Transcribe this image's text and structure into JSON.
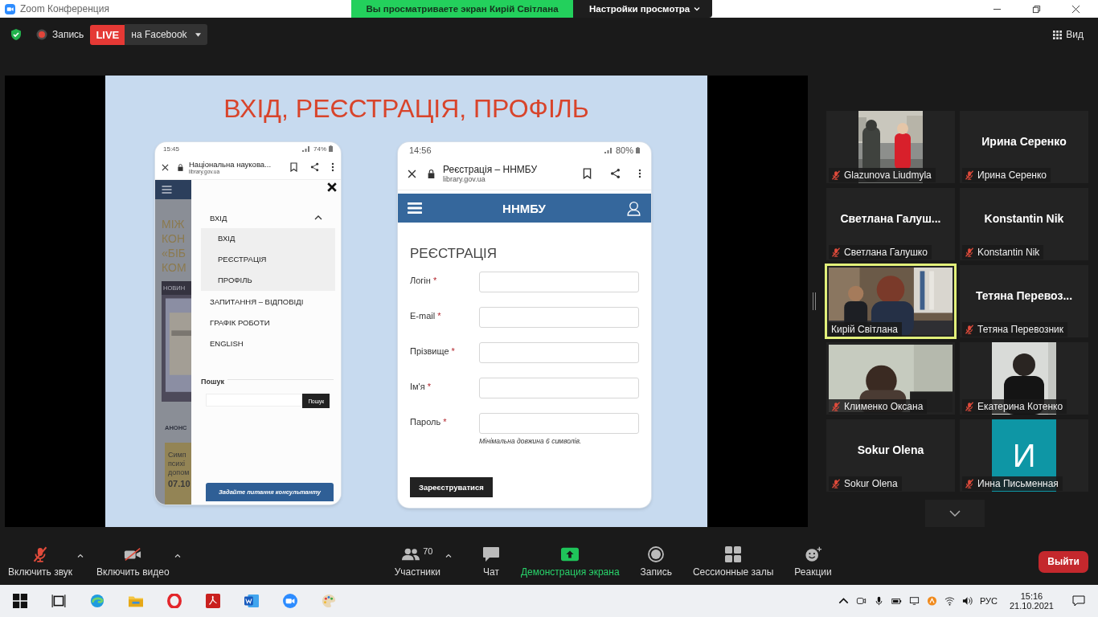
{
  "window": {
    "title": "Zoom Конференция"
  },
  "share_banner": {
    "text": "Вы просматриваете экран Кирій Світлана",
    "options": "Настройки просмотра"
  },
  "top_toolbar": {
    "record_label": "Запись",
    "live_badge": "LIVE",
    "stream_target": "на Facebook",
    "view_label": "Вид"
  },
  "slide": {
    "title": "ВХІД, РЕЄСТРАЦІЯ, ПРОФІЛЬ",
    "left_phone": {
      "time": "15:45",
      "battery": "74%",
      "page_title": "Національна наукова...",
      "url": "library.gov.ua",
      "background_texts": [
        "МІЖ",
        "КОН",
        "«БІБ",
        "КОМ"
      ],
      "news_label": "НОВИН",
      "announce_label": "АНОНС",
      "card_texts": [
        "Симп",
        "психі",
        "допом"
      ],
      "card_date": "07.10",
      "menu": [
        {
          "label": "ВХІД",
          "expanded": true,
          "children": [
            {
              "label": "ВХІД"
            },
            {
              "label": "РЕЄСТРАЦІЯ"
            },
            {
              "label": "ПРОФІЛЬ"
            }
          ]
        },
        {
          "label": "ЗАПИТАННЯ – ВІДПОВІДІ"
        },
        {
          "label": "ГРАФІК РОБОТИ"
        },
        {
          "label": "ENGLISH"
        }
      ],
      "search_label": "Пошук",
      "search_button": "Пошук",
      "consult_button": "Задайте питання консультанту"
    },
    "right_phone": {
      "time": "14:56",
      "battery": "80%",
      "page_title": "Реєстрація – ННМБУ",
      "url": "library.gov.ua",
      "site_name": "ННМБУ",
      "heading": "РЕЄСТРАЦІЯ",
      "fields": [
        {
          "label": "Логін",
          "required_mark": "*"
        },
        {
          "label": "E-mail",
          "required_mark": "*"
        },
        {
          "label": "Прізвище",
          "required_mark": "*"
        },
        {
          "label": "Ім'я",
          "required_mark": "*"
        },
        {
          "label": "Пароль",
          "required_mark": "*",
          "hint": "Мінімальна довжина 6 символів."
        }
      ],
      "submit": "Зареєструватися"
    }
  },
  "participants": [
    {
      "kind": "portrait",
      "name": "Glazunova Liudmyla",
      "muted": true,
      "speaking": false
    },
    {
      "kind": "name",
      "display": "Ирина Серенко",
      "name": "Ирина Серенко",
      "muted": true,
      "speaking": false
    },
    {
      "kind": "name",
      "display": "Светлана  Галуш...",
      "name": "Светлана Галушко",
      "muted": true,
      "speaking": false
    },
    {
      "kind": "name",
      "display": "Konstantin Nik",
      "name": "Konstantin Nik",
      "muted": true,
      "speaking": false
    },
    {
      "kind": "video",
      "name": "Кирій Світлана",
      "muted": false,
      "speaking": true
    },
    {
      "kind": "name",
      "display": "Тетяна  Перевоз...",
      "name": "Тетяна Перевозник",
      "muted": true,
      "speaking": false
    },
    {
      "kind": "video",
      "name": "Клименко Оксана",
      "muted": true,
      "speaking": false
    },
    {
      "kind": "portrait",
      "name": "Екатерина Котенко",
      "muted": true,
      "speaking": false
    },
    {
      "kind": "name",
      "display": "Sokur Olena",
      "name": "Sokur Olena",
      "muted": true,
      "speaking": false
    },
    {
      "kind": "avatar",
      "letter": "И",
      "name": "Инна Письменная",
      "muted": true,
      "speaking": false
    }
  ],
  "meeting_toolbar": {
    "left": [
      {
        "label": "Включить звук",
        "caret": true
      },
      {
        "label": "Включить видео",
        "caret": true
      }
    ],
    "center": [
      {
        "label": "Участники",
        "count": "70",
        "caret": true,
        "highlighted": false
      },
      {
        "label": "Чат",
        "caret": false,
        "highlighted": false
      },
      {
        "label": "Демонстрация экрана",
        "caret": false,
        "highlighted": true
      },
      {
        "label": "Запись",
        "caret": false,
        "highlighted": false
      },
      {
        "label": "Сессионные залы",
        "caret": false,
        "highlighted": false
      },
      {
        "label": "Реакции",
        "caret": false,
        "highlighted": false
      }
    ],
    "leave_button": "Выйти"
  },
  "taskbar": {
    "language": "РУС",
    "time": "15:16",
    "date": "21.10.2021"
  }
}
